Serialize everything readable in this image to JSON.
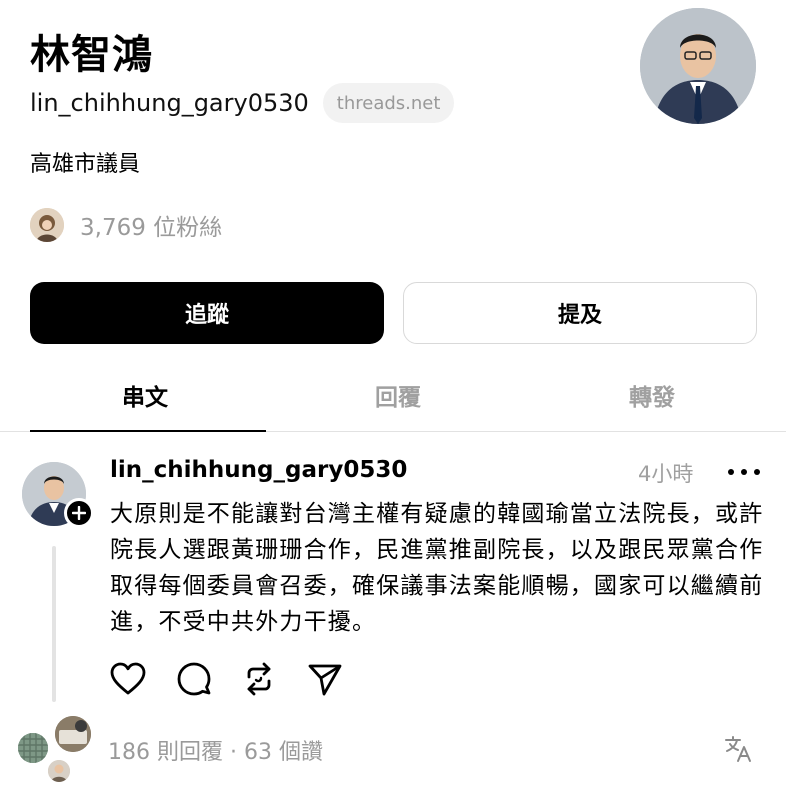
{
  "profile": {
    "display_name": "林智鴻",
    "handle": "lin_chihhung_gary0530",
    "domain_badge": "threads.net",
    "bio": "高雄市議員",
    "followers_text": "3,769 位粉絲"
  },
  "buttons": {
    "follow_label": "追蹤",
    "mention_label": "提及"
  },
  "tabs": {
    "items": [
      "串文",
      "回覆",
      "轉發"
    ],
    "active_index": 0
  },
  "post": {
    "author": "lin_chihhung_gary0530",
    "time": "4小時",
    "text": "大原則是不能讓對台灣主權有疑慮的韓國瑜當立法院長，或許院長人選跟黃珊珊合作，民進黨推副院長，以及跟民眾黨合作取得每個委員會召委，確保議事法案能順暢，國家可以繼續前進，不受中共外力干擾。",
    "stats": "186 則回覆 · 63 個讚"
  },
  "icons": {
    "more": "more-horizontal-icon",
    "like": "heart-icon",
    "comment": "comment-bubble-icon",
    "repost": "repost-icon",
    "share": "send-icon",
    "translate": "translate-icon",
    "follow": "plus-icon"
  },
  "colors": {
    "primary": "#000000",
    "muted": "#9a9a9a",
    "divider": "#e2e2e2",
    "pill_bg": "#f2f2f2"
  }
}
